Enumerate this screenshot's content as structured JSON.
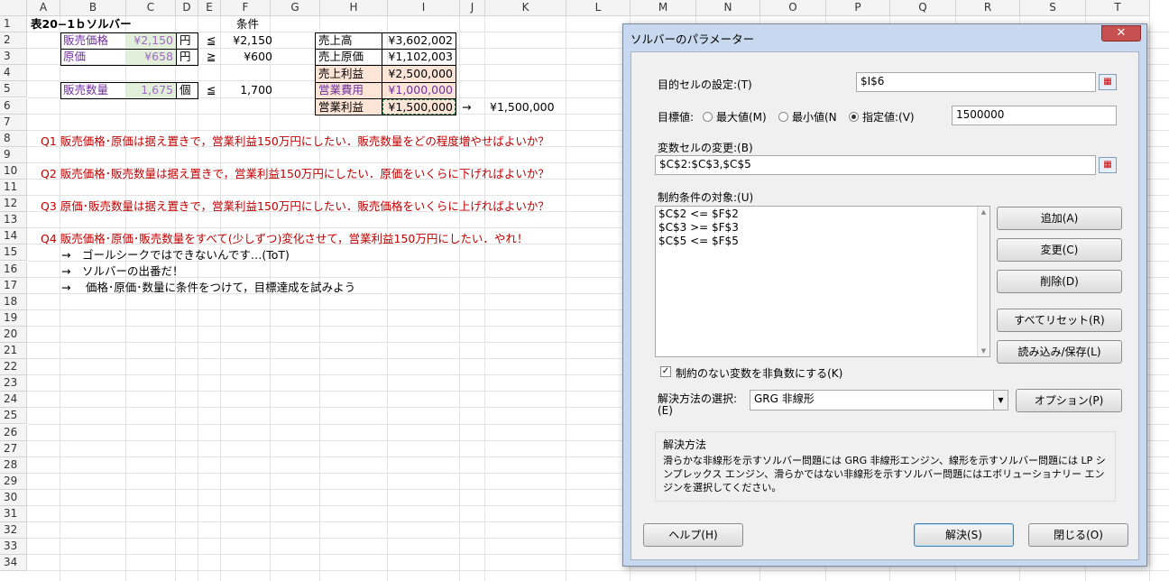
{
  "columns": [
    "A",
    "B",
    "C",
    "D",
    "E",
    "F",
    "G",
    "H",
    "I",
    "J",
    "K",
    "L",
    "M",
    "N",
    "O",
    "P",
    "Q",
    "R",
    "S",
    "T"
  ],
  "rows": [
    "1",
    "2",
    "3",
    "4",
    "5",
    "6",
    "7",
    "8",
    "9",
    "10",
    "11",
    "12",
    "13",
    "14",
    "15",
    "16",
    "17",
    "18",
    "19",
    "20",
    "21",
    "22",
    "23",
    "24",
    "25",
    "26",
    "27",
    "28",
    "29",
    "30",
    "31",
    "32",
    "33",
    "34"
  ],
  "sheet": {
    "title": "表20−1ｂソルバー",
    "cond_header": "条件",
    "price_label": "販売価格",
    "price_value": "¥2,150",
    "price_unit": "円",
    "price_op": "≦",
    "price_cond": "¥2,150",
    "cost_label": "原価",
    "cost_value": "¥658",
    "cost_unit": "円",
    "cost_op": "≧",
    "cost_cond": "¥600",
    "qty_label": "販売数量",
    "qty_value": "1,675",
    "qty_unit": "個",
    "qty_op": "≦",
    "qty_cond": "1,700",
    "summary": [
      {
        "label": "売上高",
        "value": "¥3,602,002"
      },
      {
        "label": "売上原価",
        "value": "¥1,102,003"
      },
      {
        "label": "売上利益",
        "value": "¥2,500,000"
      },
      {
        "label": "営業費用",
        "value": "¥1,000,000"
      },
      {
        "label": "営業利益",
        "value": "¥1,500,000"
      }
    ],
    "arrow": "→",
    "target": "¥1,500,000",
    "q1": "Q1 販売価格･原価は据え置きで，営業利益150万円にしたい．販売数量をどの程度増やせばよいか？",
    "q2": "Q2 販売価格･販売数量は据え置きで，営業利益150万円にしたい．原価をいくらに下げればよいか？",
    "q3": "Q3 原価･販売数量は据え置きで，営業利益150万円にしたい．販売価格をいくらに上げればよいか？",
    "q4": "Q4 販売価格･原価･販売数量をすべて(少しずつ)変化させて，営業利益150万円にしたい．やれ！",
    "n15": "→　ゴールシークではできないんです…(ToT)",
    "n16": "→　ソルバーの出番だ！",
    "n17": "→　 価格･原価･数量に条件をつけて，目標達成を試みよう"
  },
  "dialog": {
    "title": "ソルバーのパラメーター",
    "close": "✕",
    "objective_label": "目的セルの設定:(T)",
    "objective_value": "$I$6",
    "goal_label": "目標値:",
    "opt_max": "最大値(M)",
    "opt_min": "最小値(N",
    "opt_value": "指定値:(V)",
    "goal_value": "1500000",
    "variable_label": "変数セルの変更:(B)",
    "variable_value": "$C$2:$C$3,$C$5",
    "constraints_label": "制約条件の対象:(U)",
    "constraints": [
      "$C$2 <= $F$2",
      "$C$3 >= $F$3",
      "$C$5 <= $F$5"
    ],
    "btn_add": "追加(A)",
    "btn_change": "変更(C)",
    "btn_delete": "削除(D)",
    "btn_reset": "すべてリセット(R)",
    "btn_load": "読み込み/保存(L)",
    "nonneg_label": "制約のない変数を非負数にする(K)",
    "method_label": "解決方法の選択:",
    "method_label2": "(E)",
    "method_value": "GRG 非線形",
    "btn_options": "オプション(P)",
    "method_group": "解決方法",
    "method_desc": "滑らかな非線形を示すソルバー問題には GRG 非線形エンジン、線形を示すソルバー問題には LP シンプレックス エンジン、滑らかではない非線形を示すソルバー問題にはエボリューショナリー エンジンを選択してください。",
    "btn_help": "ヘルプ(H)",
    "btn_solve": "解決(S)",
    "btn_close": "閉じる(O)"
  }
}
